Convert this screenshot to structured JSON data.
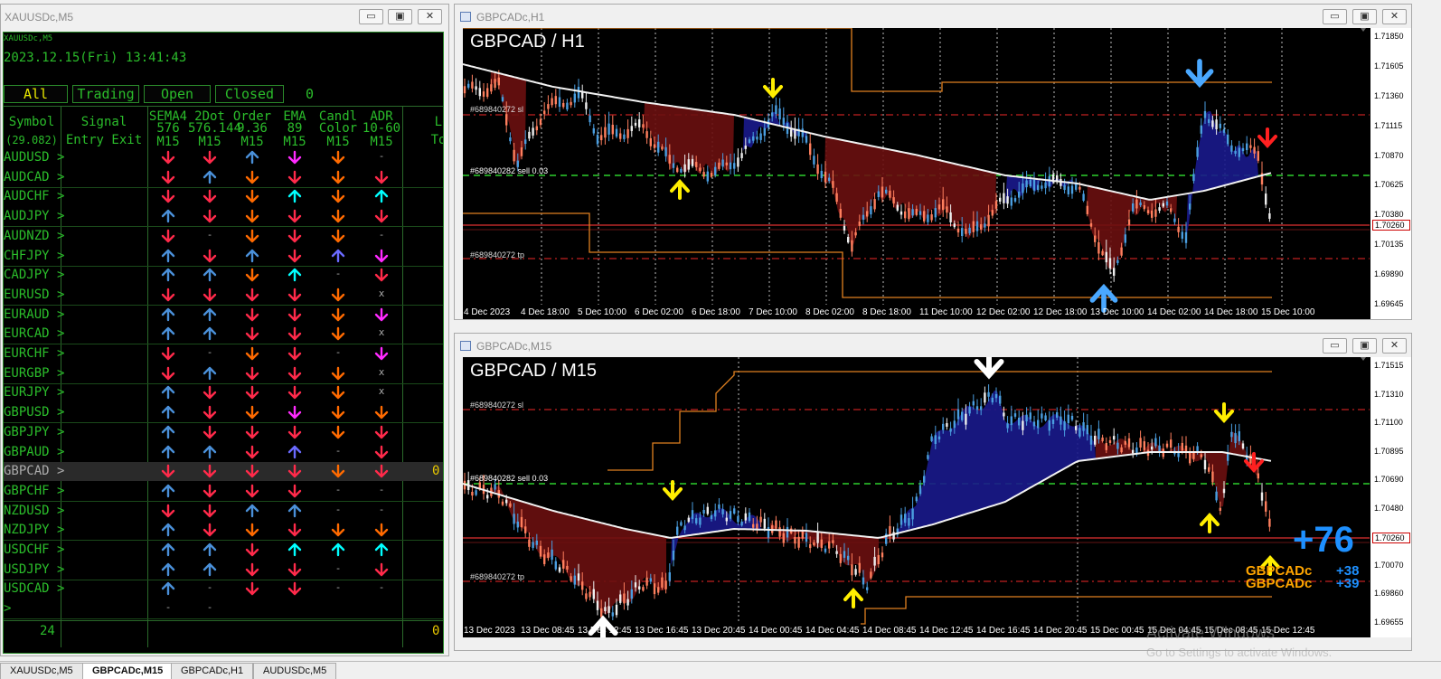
{
  "dashboard_window": {
    "title": "XAUUSDc,M5"
  },
  "dashboard": {
    "header_symbol": "XAUUSDc,M5",
    "datetime": "2023.12.15(Fri) 13:41:43",
    "filters": [
      "All",
      "Trading",
      "Open",
      "Closed"
    ],
    "filter_count": "0",
    "col_symbol": "Symbol",
    "col_symbol_sub": "(29.082)",
    "col_signal": "Signal",
    "col_signal_sub": "Entry Exit",
    "columns": [
      {
        "l1": "SEMA4",
        "l2": "576",
        "l3": "M15"
      },
      {
        "l1": "2Dot",
        "l2": "576.144",
        "l3": "M15"
      },
      {
        "l1": "Order",
        "l2": "9.36",
        "l3": "M15"
      },
      {
        "l1": "EMA",
        "l2": "89",
        "l3": "M15"
      },
      {
        "l1": "Candl",
        "l2": "Color",
        "l3": "M15"
      },
      {
        "l1": "ADR",
        "l2": "10-60",
        "l3": "M15"
      }
    ],
    "col_last": "Lo",
    "col_last_sub": "To",
    "rows": [
      {
        "s": "AUDUSD",
        "a": [
          "dr",
          "dr",
          "up",
          "dm",
          "do",
          "dash"
        ]
      },
      {
        "s": "AUDCAD",
        "a": [
          "dr",
          "ub",
          "do",
          "dr",
          "do",
          "dr"
        ]
      },
      {
        "s": "AUDCHF",
        "a": [
          "dr",
          "dr",
          "do",
          "uc",
          "do",
          "uc"
        ]
      },
      {
        "s": "AUDJPY",
        "a": [
          "ub",
          "dr",
          "do",
          "dr",
          "do",
          "dr"
        ]
      },
      {
        "s": "AUDNZD",
        "a": [
          "dr",
          "dash",
          "do",
          "dr",
          "do",
          "dash"
        ]
      },
      {
        "s": "CHFJPY",
        "a": [
          "ub",
          "dr",
          "up",
          "dr",
          "upu",
          "dm"
        ]
      },
      {
        "s": "CADJPY",
        "a": [
          "ub",
          "ub",
          "do",
          "uc",
          "dash",
          "dr"
        ]
      },
      {
        "s": "EURUSD",
        "a": [
          "dr",
          "dr",
          "dr",
          "dr",
          "do",
          "x"
        ]
      },
      {
        "s": "EURAUD",
        "a": [
          "ub",
          "ub",
          "dr",
          "dr",
          "do",
          "dm"
        ]
      },
      {
        "s": "EURCAD",
        "a": [
          "ub",
          "ub",
          "dr",
          "dr",
          "do",
          "x"
        ]
      },
      {
        "s": "EURCHF",
        "a": [
          "dr",
          "dash",
          "do",
          "dr",
          "dash",
          "dm"
        ]
      },
      {
        "s": "EURGBP",
        "a": [
          "dr",
          "ub",
          "dr",
          "dr",
          "do",
          "x"
        ]
      },
      {
        "s": "EURJPY",
        "a": [
          "ub",
          "dr",
          "dr",
          "dr",
          "do",
          "x"
        ]
      },
      {
        "s": "GBPUSD",
        "a": [
          "ub",
          "dr",
          "do",
          "dm",
          "do",
          "do"
        ]
      },
      {
        "s": "GBPJPY",
        "a": [
          "ub",
          "dr",
          "dr",
          "dr",
          "do",
          "dr"
        ]
      },
      {
        "s": "GBPAUD",
        "a": [
          "ub",
          "ub",
          "dr",
          "upu",
          "dash",
          "dr"
        ]
      },
      {
        "s": "GBPCAD",
        "a": [
          "dr",
          "dr",
          "dr",
          "dr",
          "do",
          "dr"
        ],
        "sel": true,
        "v": "0"
      },
      {
        "s": "GBPCHF",
        "a": [
          "ub",
          "dr",
          "dr",
          "dr",
          "dash",
          "dash"
        ]
      },
      {
        "s": "NZDUSD",
        "a": [
          "dr",
          "dr",
          "up",
          "up",
          "dash",
          "dash"
        ]
      },
      {
        "s": "NZDJPY",
        "a": [
          "ub",
          "dr",
          "do",
          "dr",
          "do",
          "do"
        ]
      },
      {
        "s": "USDCHF",
        "a": [
          "ub",
          "ub",
          "dr",
          "uc",
          "uc",
          "uc"
        ]
      },
      {
        "s": "USDJPY",
        "a": [
          "ub",
          "ub",
          "dr",
          "dr",
          "dash",
          "dr"
        ]
      },
      {
        "s": "USDCAD",
        "a": [
          "ub",
          "dash",
          "dr",
          "dr",
          "dash",
          "dash"
        ]
      },
      {
        "s": "",
        "a": [
          "dash",
          "dash",
          "",
          "",
          "",
          ""
        ]
      }
    ],
    "footer_count": "24",
    "footer_right": "0"
  },
  "h1_window": {
    "title": "GBPCADc,H1"
  },
  "h1_chart": {
    "title": "GBPCAD / H1",
    "prices": [
      "1.71850",
      "1.71605",
      "1.71360",
      "1.71115",
      "1.70870",
      "1.70625",
      "1.70380",
      "1.70135",
      "1.69890",
      "1.69645"
    ],
    "current_price": "1.70260",
    "xlabels": [
      "4 Dec 2023",
      "4 Dec 18:00",
      "5 Dec 10:00",
      "6 Dec 02:00",
      "6 Dec 18:00",
      "7 Dec 10:00",
      "8 Dec 02:00",
      "8 Dec 18:00",
      "11 Dec 10:00",
      "12 Dec 02:00",
      "12 Dec 18:00",
      "13 Dec 10:00",
      "14 Dec 02:00",
      "14 Dec 18:00",
      "15 Dec 10:00"
    ],
    "labels": {
      "sl": "#689840272 sl",
      "sell": "#689840282 sell 0.03",
      "tp": "#689840272 tp"
    }
  },
  "m15_window": {
    "title": "GBPCADc,M15"
  },
  "m15_chart": {
    "title": "GBPCAD / M15",
    "prices": [
      "1.71515",
      "1.71310",
      "1.71100",
      "1.70895",
      "1.70690",
      "1.70480",
      "1.70260",
      "1.70070",
      "1.69860",
      "1.69655"
    ],
    "current_price": "1.70260",
    "xlabels": [
      "13 Dec 2023",
      "13 Dec 08:45",
      "13 Dec 12:45",
      "13 Dec 16:45",
      "13 Dec 20:45",
      "14 Dec 00:45",
      "14 Dec 04:45",
      "14 Dec 08:45",
      "14 Dec 12:45",
      "14 Dec 16:45",
      "14 Dec 20:45",
      "15 Dec 00:45",
      "15 Dec 04:45",
      "15 Dec 08:45",
      "15 Dec 12:45"
    ],
    "labels": {
      "sl": "#689840272 sl",
      "sell": "#689840282 sell 0.03",
      "tp": "#689840272 tp"
    },
    "profit_big": "+76",
    "profit_rows": [
      {
        "sym": "GBPCADc",
        "val": "+38"
      },
      {
        "sym": "GBPCADc",
        "val": "+39"
      }
    ]
  },
  "watermark": {
    "line1": "Activate Windows",
    "line2": "Go to Settings to activate Windows."
  },
  "bottom_tabs": [
    "XAUUSDc,M5",
    "GBPCADc,M15",
    "GBPCADc,H1",
    "AUDUSDc,M5"
  ],
  "colors": {
    "bull": "#4a9ee0",
    "bear": "#ff7f5e",
    "red_arrow": "#ff2a4a",
    "blue_arrow": "#4a90d9",
    "orange_arrow": "#ff6a00",
    "cyan_arrow": "#00ffff",
    "magenta_arrow": "#ff2aff",
    "purple_arrow": "#6a6aff",
    "green_text": "#2bbd2b",
    "profit": "#1e90ff",
    "gold": "#ffa500"
  }
}
